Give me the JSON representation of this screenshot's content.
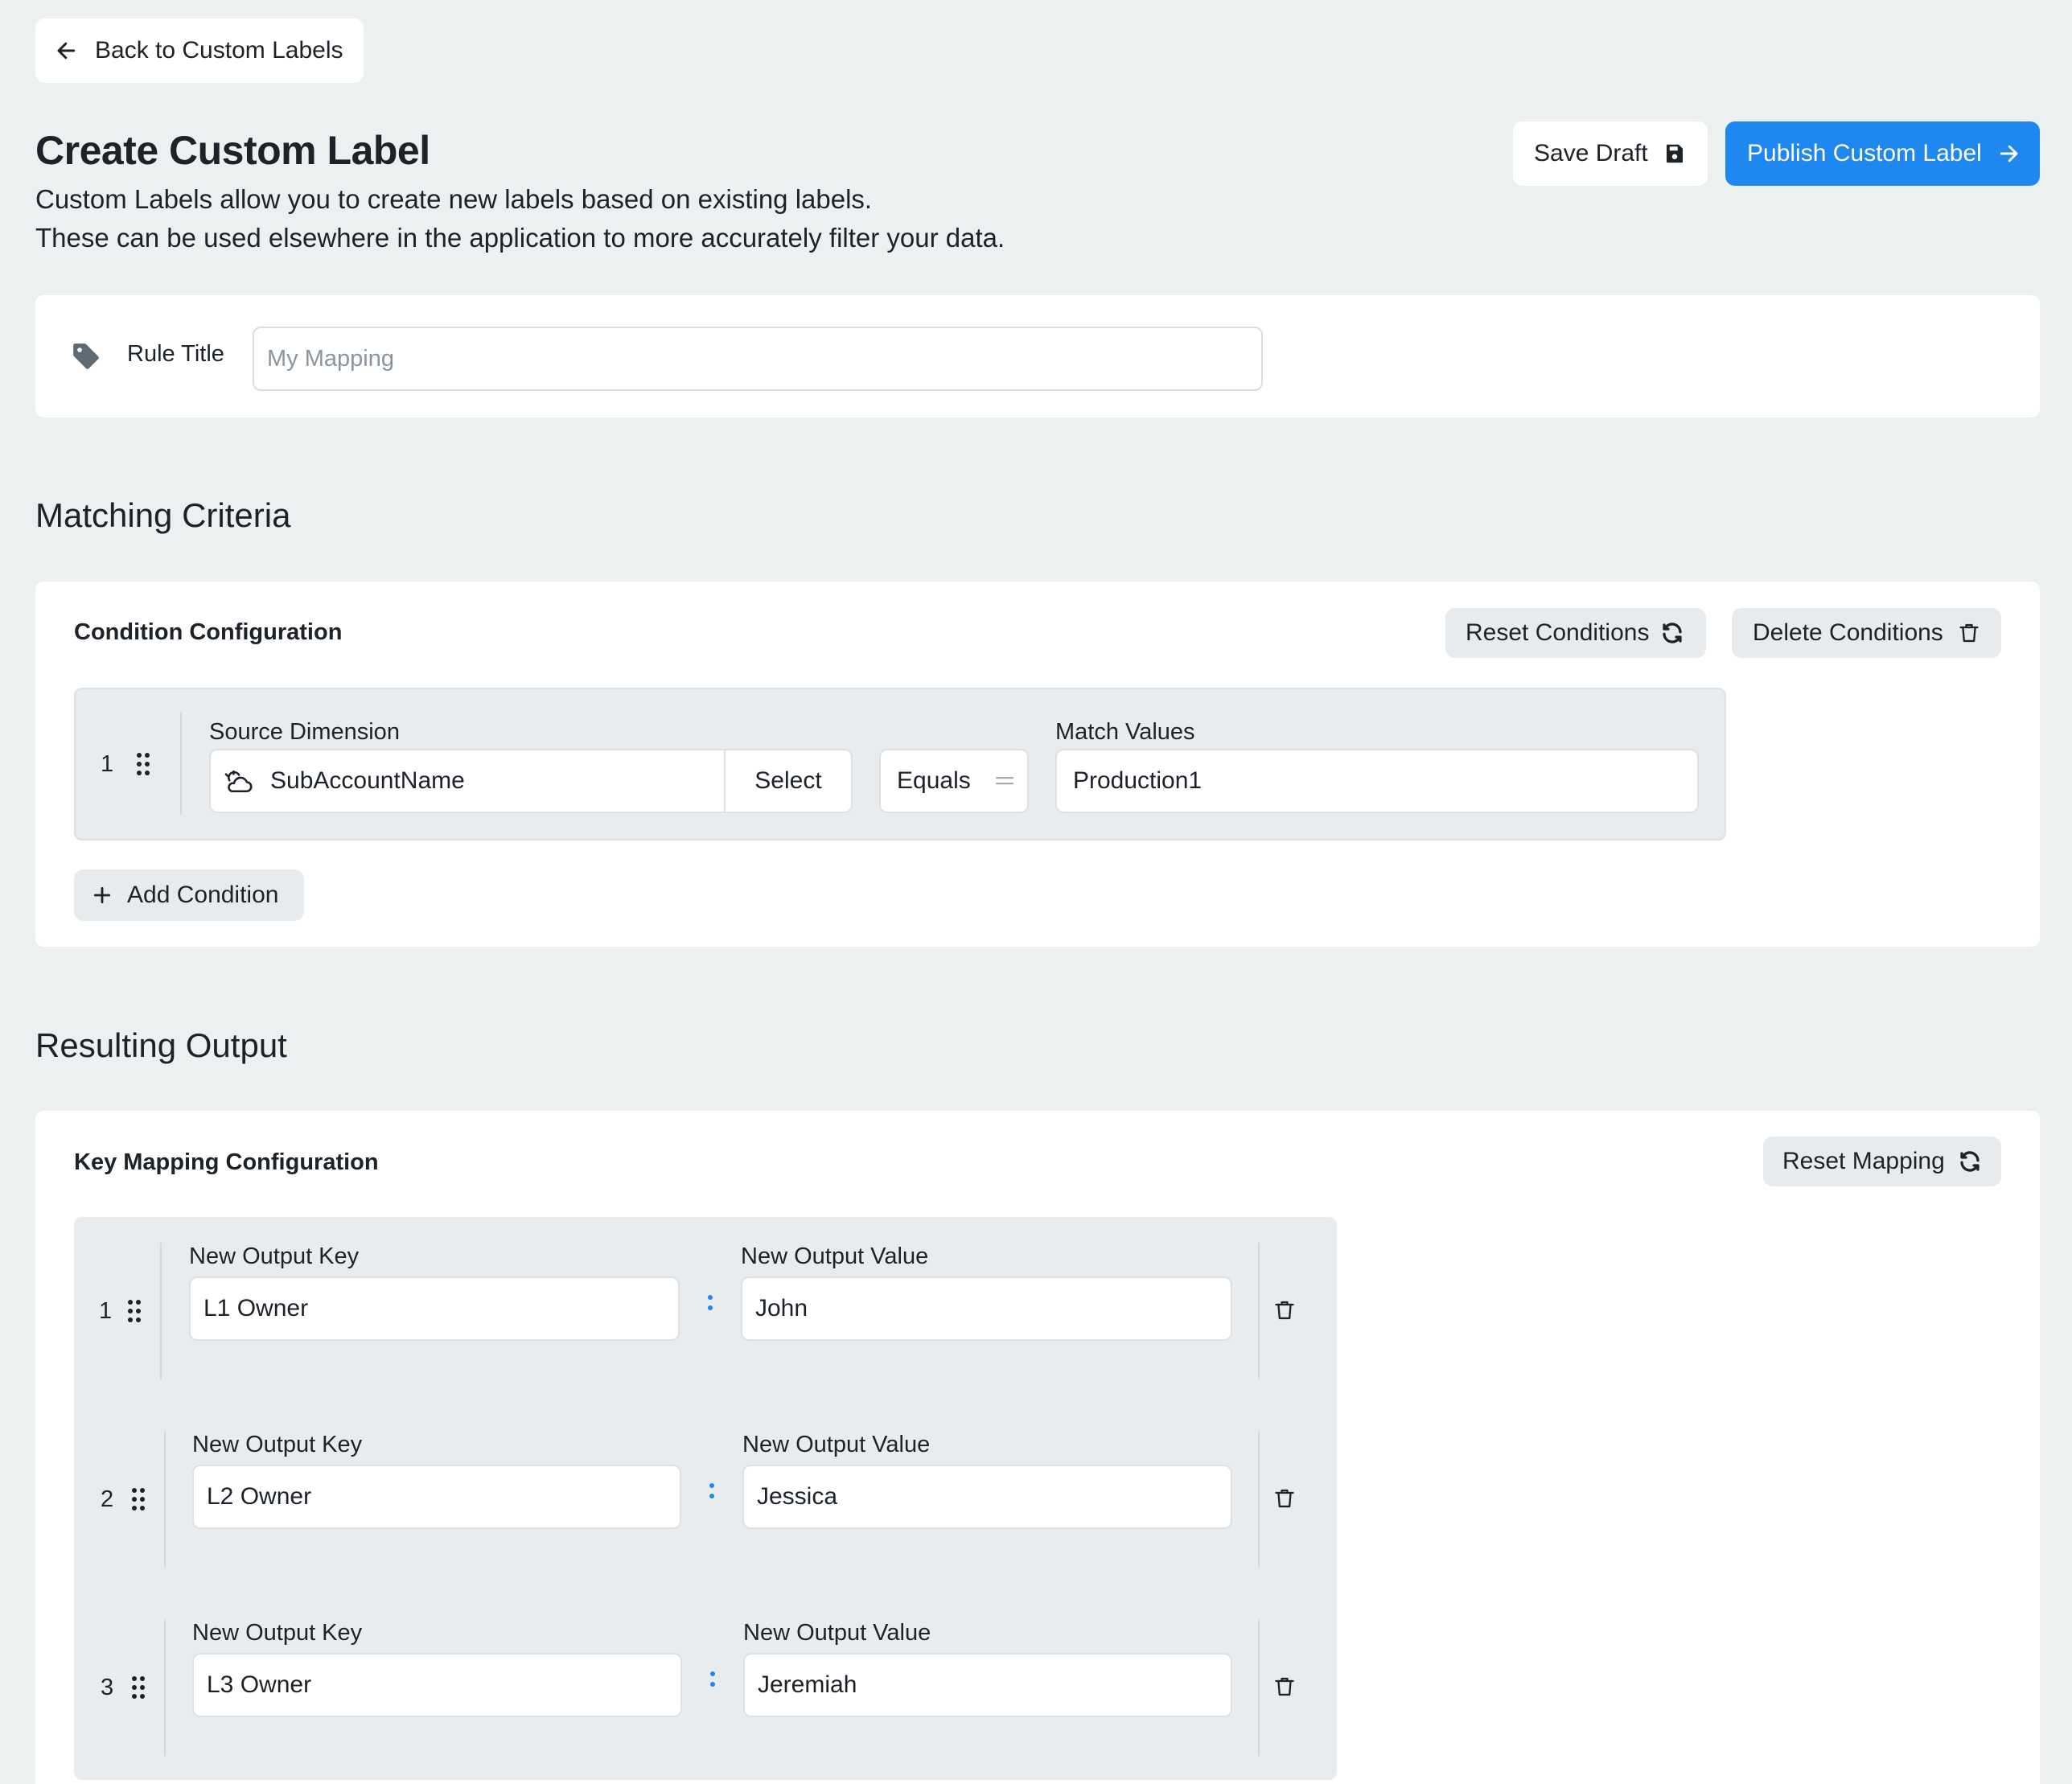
{
  "nav": {
    "back_label": "Back to Custom Labels"
  },
  "header": {
    "title": "Create Custom Label",
    "description_line1": "Custom Labels allow you to create new labels based on existing labels.",
    "description_line2": "These can be used elsewhere in the application to more accurately filter your data.",
    "save_label": "Save Draft",
    "publish_label": "Publish Custom Label"
  },
  "rule": {
    "label": "Rule Title",
    "placeholder": "My Mapping",
    "value": ""
  },
  "matching": {
    "heading": "Matching Criteria",
    "card_title": "Condition Configuration",
    "reset_label": "Reset Conditions",
    "delete_label": "Delete Conditions",
    "add_label": "Add Condition",
    "conditions": [
      {
        "number": "1",
        "source_label": "Source Dimension",
        "source_value": "SubAccountName",
        "select_label": "Select",
        "operator": "Equals",
        "match_label": "Match Values",
        "match_value": "Production1"
      }
    ]
  },
  "output": {
    "heading": "Resulting Output",
    "card_title": "Key Mapping Configuration",
    "reset_label": "Reset Mapping",
    "mappings": [
      {
        "number": "1",
        "key_label": "New Output Key",
        "key": "L1 Owner",
        "value_label": "New Output Value",
        "value": "John"
      },
      {
        "number": "2",
        "key_label": "New Output Key",
        "key": "L2 Owner",
        "value_label": "New Output Value",
        "value": "Jessica"
      },
      {
        "number": "3",
        "key_label": "New Output Key",
        "key": "L3 Owner",
        "value_label": "New Output Value",
        "value": "Jeremiah"
      }
    ]
  },
  "colors": {
    "accent": "#1e87f0",
    "background": "#edf0f1",
    "panel": "#e9ecee"
  }
}
